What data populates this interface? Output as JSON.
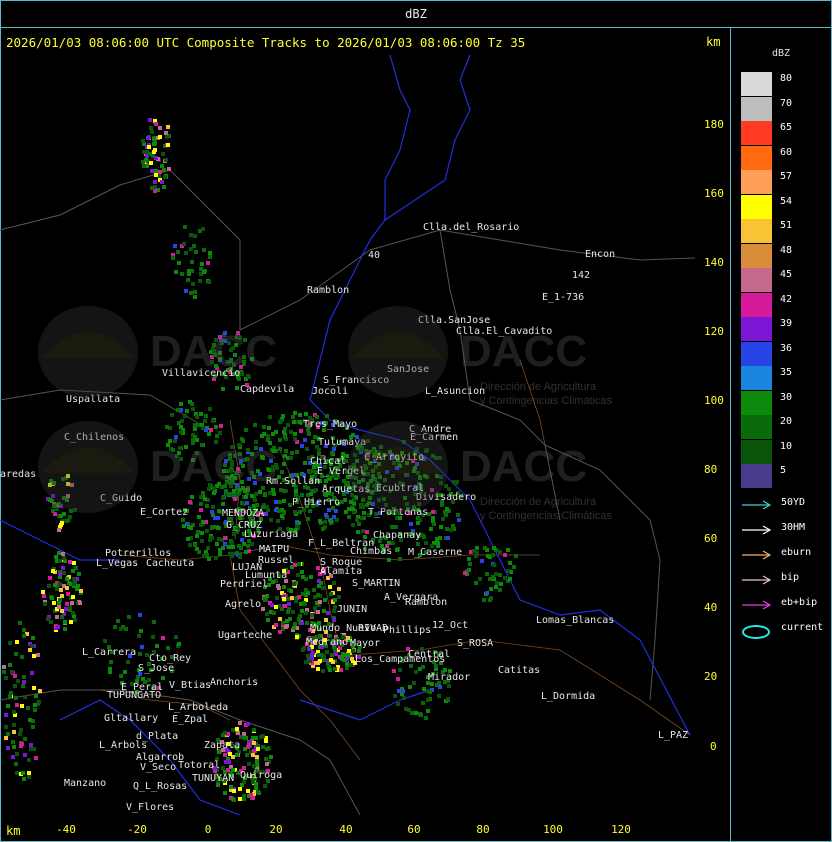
{
  "top_title": "dBZ",
  "header": "2026/01/03 08:06:00 UTC Composite Tracks to 2026/01/03 08:06:00 Tz 35",
  "km_label": "km",
  "y_ticks": [
    "180",
    "160",
    "140",
    "120",
    "100",
    "80",
    "60",
    "40",
    "20",
    "0"
  ],
  "x_ticks": [
    "-40",
    "-20",
    "0",
    "20",
    "40",
    "60",
    "80",
    "100",
    "120"
  ],
  "legend": {
    "unit": "dBZ",
    "levels": [
      {
        "value": "80",
        "color": "#d9d9d9"
      },
      {
        "value": "70",
        "color": "#bdbdbd"
      },
      {
        "value": "65",
        "color": "#ff3b24"
      },
      {
        "value": "60",
        "color": "#ff6a10"
      },
      {
        "value": "57",
        "color": "#ff9f5a"
      },
      {
        "value": "54",
        "color": "#ffff00"
      },
      {
        "value": "51",
        "color": "#f8c334"
      },
      {
        "value": "48",
        "color": "#d98c3a"
      },
      {
        "value": "45",
        "color": "#c46a8e"
      },
      {
        "value": "42",
        "color": "#d61a9b"
      },
      {
        "value": "39",
        "color": "#7b16d4"
      },
      {
        "value": "36",
        "color": "#2745e6"
      },
      {
        "value": "35",
        "color": "#1a86e0"
      },
      {
        "value": "30",
        "color": "#0c8a0c"
      },
      {
        "value": "20",
        "color": "#0a6b0a"
      },
      {
        "value": "10",
        "color": "#0b540b"
      },
      {
        "value": "5",
        "color": "#4a3a8c"
      }
    ],
    "tracks": [
      {
        "label": "50YD",
        "color": "#3fd3d3"
      },
      {
        "label": "30HM",
        "color": "#ffffff"
      },
      {
        "label": "eburn",
        "color": "#f0b070"
      },
      {
        "label": "bip",
        "color": "#f0c0c8"
      },
      {
        "label": "eb+bip",
        "color": "#e040e0"
      },
      {
        "label": "current",
        "color": "#30e0e0"
      }
    ]
  },
  "watermark": {
    "brand": "DACC",
    "line1": "Dirección de Agricultura",
    "line2": "y Contingencias Climáticas"
  },
  "places": [
    {
      "name": "Clla.del_Rosario"
    },
    {
      "name": "Encon"
    },
    {
      "name": "E_1-736"
    },
    {
      "name": "142"
    },
    {
      "name": "Ramblon"
    },
    {
      "name": "Clla.SanJose"
    },
    {
      "name": "Clla.El_Cavadito"
    },
    {
      "name": "40"
    },
    {
      "name": "Villavicencio"
    },
    {
      "name": "Capdevila"
    },
    {
      "name": "S_Francisco"
    },
    {
      "name": "Jocoli"
    },
    {
      "name": "SanJose"
    },
    {
      "name": "L_Asuncion"
    },
    {
      "name": "Uspallata"
    },
    {
      "name": "Tres_Mayo"
    },
    {
      "name": "Tulumaya"
    },
    {
      "name": "E_Carmen"
    },
    {
      "name": "C_Andre"
    },
    {
      "name": "C_Chilenos"
    },
    {
      "name": "C_Arroyito"
    },
    {
      "name": "Chical"
    },
    {
      "name": "E_Vergel"
    },
    {
      "name": "aredas"
    },
    {
      "name": "Rm.Sollan"
    },
    {
      "name": "Arquetas"
    },
    {
      "name": "Ecubtral"
    },
    {
      "name": "Divisadero"
    },
    {
      "name": "P_Hierro"
    },
    {
      "name": "C_Guido"
    },
    {
      "name": "MENDOZA"
    },
    {
      "name": "E_Cortez"
    },
    {
      "name": "T_Portenas"
    },
    {
      "name": "G_CRUZ"
    },
    {
      "name": "Luzuriaga"
    },
    {
      "name": "Chapanay"
    },
    {
      "name": "F_L_Beltran"
    },
    {
      "name": "Potrerillos"
    },
    {
      "name": "MAIPU"
    },
    {
      "name": "M_Caserne"
    },
    {
      "name": "L_Vegas"
    },
    {
      "name": "Cacheuta"
    },
    {
      "name": "Russel"
    },
    {
      "name": "S_Roque"
    },
    {
      "name": "Chimbas"
    },
    {
      "name": "LUJAN"
    },
    {
      "name": "Lumunta"
    },
    {
      "name": "Alamita"
    },
    {
      "name": "S_MARTIN"
    },
    {
      "name": "Perdriel"
    },
    {
      "name": "A_Vergara"
    },
    {
      "name": "Ramblon"
    },
    {
      "name": "Agrelo"
    },
    {
      "name": "JUNIN"
    },
    {
      "name": "Lomas_Blancas"
    },
    {
      "name": "12_Oct"
    },
    {
      "name": "RIVAD"
    },
    {
      "name": "Phillips"
    },
    {
      "name": "Ugarteche"
    },
    {
      "name": "Mundo_Nuevo"
    },
    {
      "name": "S_ROSA"
    },
    {
      "name": "L_Carrera"
    },
    {
      "name": "Cto_Rey"
    },
    {
      "name": "Medrano"
    },
    {
      "name": "Los_Campamentos"
    },
    {
      "name": "Central"
    },
    {
      "name": "Catitas"
    },
    {
      "name": "S_Jose"
    },
    {
      "name": "E_Peral"
    },
    {
      "name": "V_Btias"
    },
    {
      "name": "Anchoris"
    },
    {
      "name": "TUPUNGATO"
    },
    {
      "name": "Mirador"
    },
    {
      "name": "L_Dormida"
    },
    {
      "name": "L_Arboleda"
    },
    {
      "name": "Gltallary"
    },
    {
      "name": "E_Zpal"
    },
    {
      "name": "L_Arbols"
    },
    {
      "name": "d_Plata"
    },
    {
      "name": "L_PAZ"
    },
    {
      "name": "Algarrob"
    },
    {
      "name": "V_Seco"
    },
    {
      "name": "Zapata"
    },
    {
      "name": "Manzano"
    },
    {
      "name": "Totoral"
    },
    {
      "name": "TUNUYAN"
    },
    {
      "name": "Q_L_Rosas"
    },
    {
      "name": "V_Flores"
    },
    {
      "name": "Quiroga"
    },
    {
      "name": "Mayor"
    }
  ]
}
